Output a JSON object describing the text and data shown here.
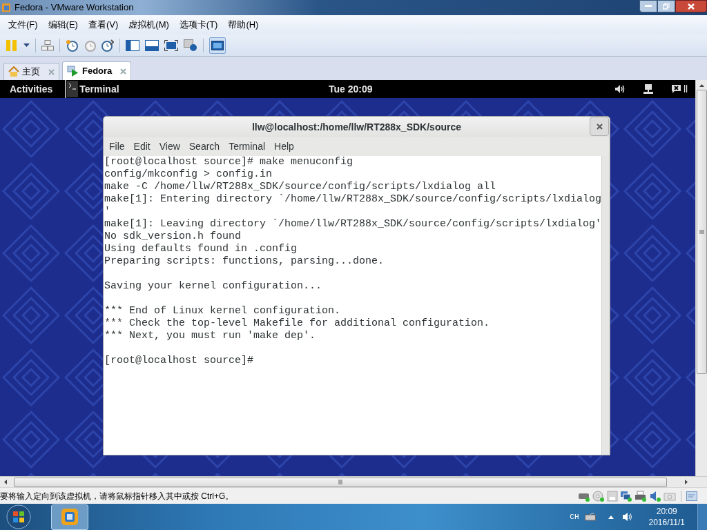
{
  "window": {
    "title": "Fedora - VMware Workstation"
  },
  "menu": [
    "文件(F)",
    "编辑(E)",
    "查看(V)",
    "虚拟机(M)",
    "选项卡(T)",
    "帮助(H)"
  ],
  "tabs": [
    {
      "label": "主页",
      "kind": "home",
      "selected": false
    },
    {
      "label": "Fedora",
      "kind": "vm",
      "selected": true
    }
  ],
  "guest": {
    "top_bar": {
      "activities": "Activities",
      "app": "Terminal",
      "clock": "Tue 20:09",
      "user": "ll"
    },
    "terminal": {
      "title": "llw@localhost:/home/llw/RT288x_SDK/source",
      "menu": [
        "File",
        "Edit",
        "View",
        "Search",
        "Terminal",
        "Help"
      ],
      "blocks": [
        [
          "[root@localhost source]# make menuconfig",
          "config/mkconfig > config.in",
          "make -C /home/llw/RT288x_SDK/source/config/scripts/lxdialog all",
          "make[1]: Entering directory `/home/llw/RT288x_SDK/source/config/scripts/lxdialog",
          "'",
          "make[1]: Leaving directory `/home/llw/RT288x_SDK/source/config/scripts/lxdialog'",
          "No sdk_version.h found",
          "Using defaults found in .config",
          "Preparing scripts: functions, parsing...done."
        ],
        [
          "Saving your kernel configuration..."
        ],
        [
          "*** End of Linux kernel configuration.",
          "*** Check the top-level Makefile for additional configuration.",
          "*** Next, you must run 'make dep'."
        ],
        [
          "[root@localhost source]#"
        ]
      ]
    }
  },
  "status_bar": {
    "message": "要将输入定向到该虚拟机，请将鼠标指针移入其中或按 Ctrl+G。"
  },
  "taskbar": {
    "ime": "CH",
    "time": "20:09",
    "date": "2016/11/1"
  }
}
